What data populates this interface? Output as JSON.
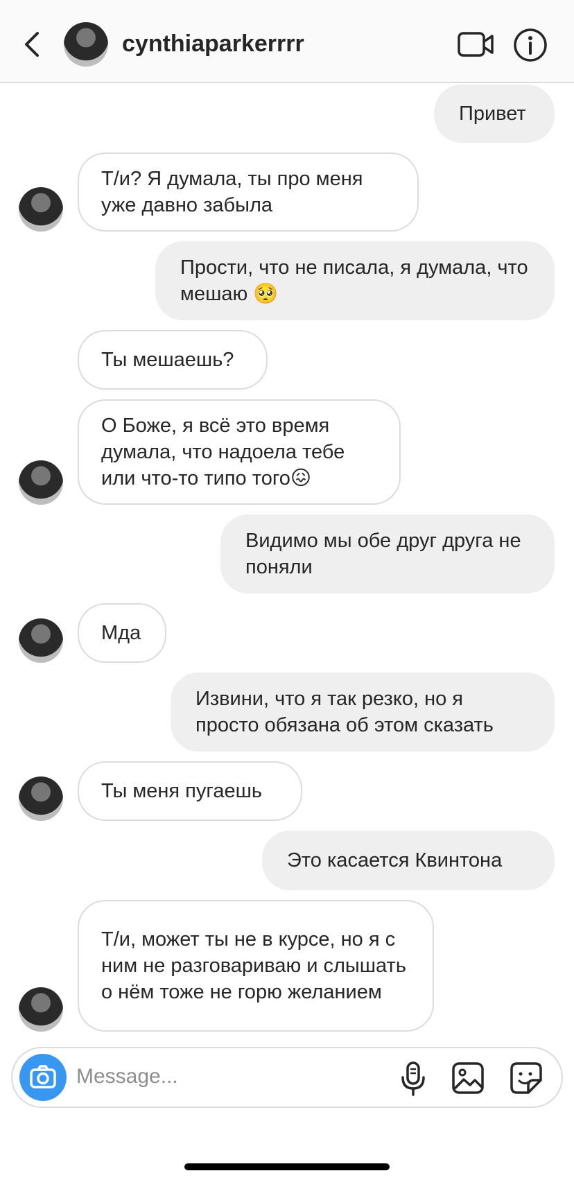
{
  "header": {
    "username": "cynthiaparkerrrr",
    "back_icon": "chevron-left-icon",
    "video_icon": "video-camera-icon",
    "info_icon": "info-icon"
  },
  "messages": [
    {
      "dir": "out",
      "text": "Привет"
    },
    {
      "dir": "in",
      "text": "Т/и? Я думала, ты про меня уже давно забыла"
    },
    {
      "dir": "out",
      "text": "Прости, что не писала, я думала, что мешаю 🥺"
    },
    {
      "dir": "in",
      "text": "Ты мешаешь?"
    },
    {
      "dir": "in",
      "text": "О Боже, я всё это время думала, что надоела тебе или что-то типо того😖"
    },
    {
      "dir": "out",
      "text": "Видимо мы обе друг друга не поняли"
    },
    {
      "dir": "in",
      "text": "Мда"
    },
    {
      "dir": "out",
      "text": "Извини, что я так резко, но я просто обязана об этом сказать"
    },
    {
      "dir": "in",
      "text": "Ты меня пугаешь"
    },
    {
      "dir": "out",
      "text": "Это касается Квинтона"
    },
    {
      "dir": "in",
      "text": "Т/и, может ты не в курсе, но я с ним не разговариваю и слышать о нём тоже не горю желанием"
    }
  ],
  "composer": {
    "placeholder": "Message...",
    "camera_icon": "camera-icon",
    "mic_icon": "microphone-icon",
    "gallery_icon": "gallery-icon",
    "sticker_icon": "sticker-icon"
  },
  "colors": {
    "accent": "#3897f0",
    "outgoing_bubble": "#efefef",
    "border": "#dbdbdb"
  }
}
